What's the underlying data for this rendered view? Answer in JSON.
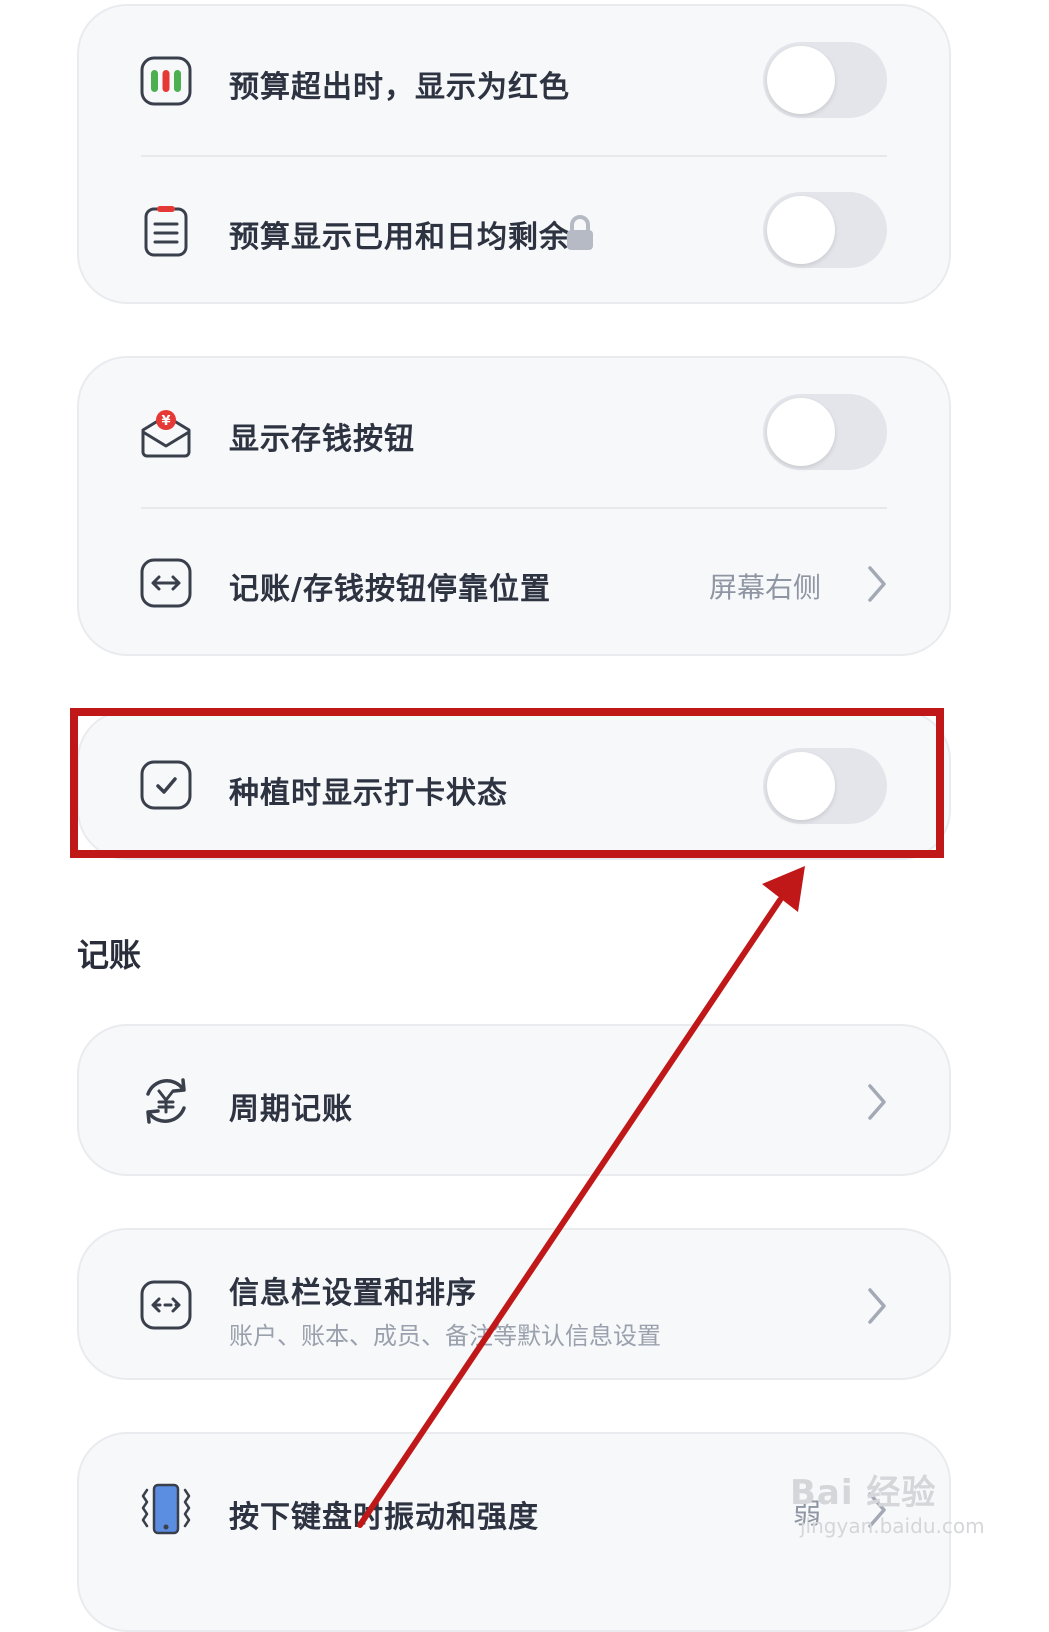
{
  "group_budget": {
    "row1_label": "预算超出时，显示为红色",
    "row2_label": "预算显示已用和日均剩余"
  },
  "group_savings": {
    "row1_label": "显示存钱按钮",
    "row2_label": "记账/存钱按钮停靠位置",
    "row2_value": "屏幕右侧"
  },
  "group_plant": {
    "row1_label": "种植时显示打卡状态"
  },
  "section_bookkeeping": {
    "title": "记账",
    "recurring_label": "周期记账",
    "infobar_label": "信息栏设置和排序",
    "infobar_subtitle": "账户、账本、成员、备注等默认信息设置",
    "keyboard_label": "按下键盘时振动和强度",
    "keyboard_value": "弱"
  },
  "watermark": {
    "main": "Bai 经验",
    "sub": "jingyan.baidu.com"
  },
  "colors": {
    "annotation_red": "#c01818",
    "icon_stroke": "#3a3f4c",
    "toggle_off": "#e3e5ea",
    "card_bg": "#f7f8fa"
  }
}
